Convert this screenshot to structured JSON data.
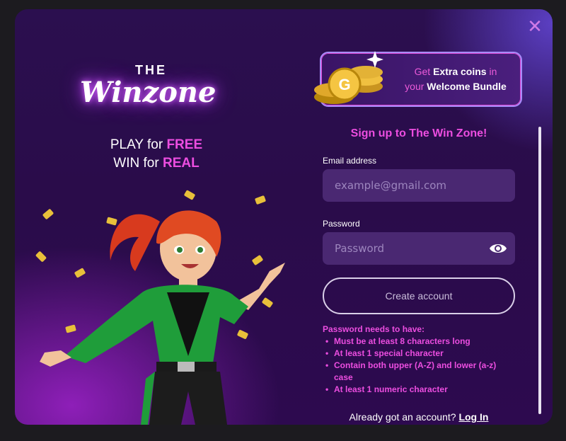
{
  "close": {
    "icon": "close-icon"
  },
  "logo": {
    "top": "THE",
    "main": "Winzone"
  },
  "tagline": {
    "line1_word1": "PLAY",
    "line1_word2": "for",
    "line1_highlight": "FREE",
    "line2_word1": "WIN",
    "line2_word2": "for",
    "line2_highlight": "REAL"
  },
  "bundle": {
    "get": "Get",
    "extra": "Extra coins",
    "in": "in",
    "your": "your",
    "welcome": "Welcome Bundle"
  },
  "form": {
    "title": "Sign up to The Win Zone!",
    "email_label": "Email address",
    "email_placeholder": "example@gmail.com",
    "password_label": "Password",
    "password_placeholder": "Password",
    "submit": "Create account"
  },
  "requirements": {
    "title": "Password needs to have:",
    "items": [
      "Must be at least 8 characters long",
      "At least 1 special character",
      "Contain both upper (A-Z) and lower (a-z) case",
      "At least 1 numeric character"
    ]
  },
  "login": {
    "prompt": "Already got an account?",
    "link": "Log In"
  },
  "colors": {
    "accent": "#ec4de0",
    "background": "#2b0f4f",
    "input": "#4a2872"
  }
}
